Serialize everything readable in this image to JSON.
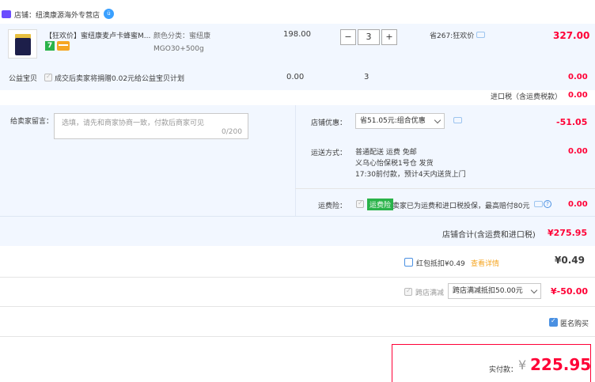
{
  "store": {
    "label": "店铺：纽澳康源海外专营店",
    "ww_badge": "ü"
  },
  "item": {
    "title": "【狂欢价】蜜纽康麦卢卡蜂蜜M...",
    "badge": "7",
    "sku": "颜色分类：蜜纽康MGO30+500g",
    "price": "198.00",
    "quantity": "3",
    "minus": "−",
    "plus": "+",
    "discount": "省267:狂欢价",
    "total": "327.00"
  },
  "welfare": {
    "label": "公益宝贝",
    "text": "成交后卖家将捐赠0.02元给公益宝贝计划",
    "price": "0.00",
    "quantity": "3",
    "total": "0.00"
  },
  "tax": {
    "label": "进口税（含运费税款）",
    "value": "0.00"
  },
  "message": {
    "label": "给卖家留言：",
    "placeholder": "选填，请先和商家协商一致，付款后商家可见",
    "count": "0/200"
  },
  "shop_discount": {
    "label": "店铺优惠：",
    "selected": "省51.05元:组合优惠",
    "value": "-51.05"
  },
  "shipping": {
    "label": "运送方式：",
    "line1": "普通配送 运费 免邮",
    "line2": "义乌心怡保税1号仓  发货",
    "line3": "17:30前付款，预计4天内送货上门",
    "value": "0.00"
  },
  "insurance": {
    "label": "运费险：",
    "badge": "运费险",
    "text": "卖家已为运费和进口税投保，最高赔付80元",
    "value": "0.00"
  },
  "subtotal": {
    "label": "店铺合计(含运费和进口税)",
    "value": "¥275.95"
  },
  "red_packet": {
    "label": "红包抵扣¥0.49",
    "link": "查看详情",
    "value": "¥0.49"
  },
  "cross_store": {
    "label": "跨店满减",
    "selected": "跨店满减抵扣50.00元",
    "value": "¥-50.00"
  },
  "anonymous": {
    "label": "匿名购买"
  },
  "payment": {
    "label": "实付款：",
    "yen": "¥",
    "value": "225.95"
  },
  "colors": {
    "accent_red": "#ff0036",
    "panel_blue": "#f2f7ff",
    "link_orange": "#f5a623"
  }
}
